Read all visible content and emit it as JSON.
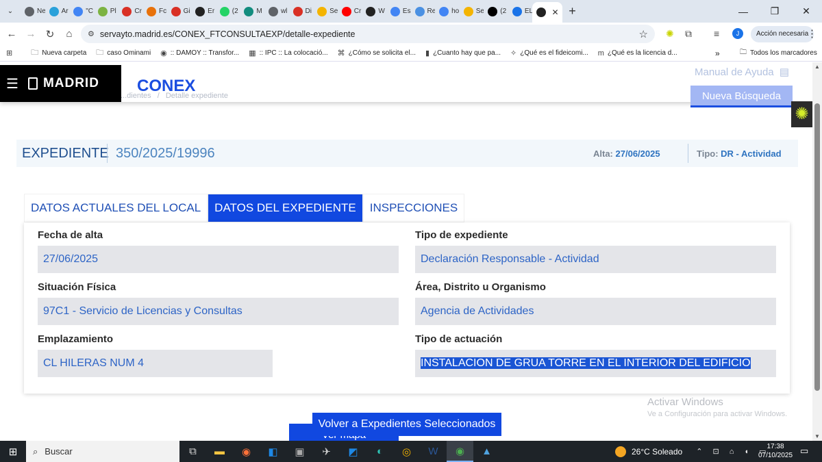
{
  "browser": {
    "tabs": [
      {
        "label": "Ne",
        "color": "#5f6368"
      },
      {
        "label": "Ar",
        "color": "#2aa1da"
      },
      {
        "label": "\"C",
        "color": "#4285f4"
      },
      {
        "label": "Pl",
        "color": "#7cb342"
      },
      {
        "label": "Cr",
        "color": "#d93025"
      },
      {
        "label": "Fc",
        "color": "#e8710a"
      },
      {
        "label": "Gi",
        "color": "#d93025"
      },
      {
        "label": "Er",
        "color": "#222222"
      },
      {
        "label": "(2",
        "color": "#25d366"
      },
      {
        "label": "M",
        "color": "#128c7e"
      },
      {
        "label": "wl",
        "color": "#5f6368"
      },
      {
        "label": "Di",
        "color": "#d93025"
      },
      {
        "label": "Se",
        "color": "#f4b400"
      },
      {
        "label": "Cr",
        "color": "#ff0000"
      },
      {
        "label": "W",
        "color": "#222222"
      },
      {
        "label": "Es",
        "color": "#4285f4"
      },
      {
        "label": "Re",
        "color": "#4a90e2"
      },
      {
        "label": "ho",
        "color": "#4285f4"
      },
      {
        "label": "Se",
        "color": "#f4b400"
      },
      {
        "label": "(2",
        "color": "#000000"
      },
      {
        "label": "EL",
        "color": "#1a73e8"
      }
    ],
    "active_tab_close": "✕",
    "new_tab": "+",
    "url": "servayto.madrid.es/CONEX_FTCONSULTAEXP/detalle-expediente",
    "accion_necesaria": "Acción necesaria",
    "profile_initial": "J",
    "bookmarks": [
      {
        "icon": "⊞",
        "label": ""
      },
      {
        "icon": "🗀",
        "label": "Nueva carpeta"
      },
      {
        "icon": "🗀",
        "label": "caso Ominami"
      },
      {
        "icon": "◉",
        "label": ":: DAMOY :: Transfor..."
      },
      {
        "icon": "▦",
        "label": ":: IPC :: La colocació..."
      },
      {
        "icon": "⌘",
        "label": "¿Cómo se solicita el..."
      },
      {
        "icon": "▮",
        "label": "¿Cuanto hay que pa..."
      },
      {
        "icon": "✧",
        "label": "¿Qué es el fideicomi..."
      },
      {
        "icon": "m",
        "label": "¿Qué es la licencia d..."
      }
    ],
    "bookmarks_more": "»",
    "all_bookmarks": "Todos los marcadores"
  },
  "site": {
    "brand": "MADRID",
    "app_name": "CONEX",
    "breadcrumb_left": "...dientes",
    "breadcrumb_sep": "/",
    "breadcrumb_current": "Detalle expediente",
    "manual": "Manual de Ayuda",
    "nueva_busqueda": "Nueva Búsqueda"
  },
  "expediente": {
    "label": "EXPEDIENTE",
    "numero": "350/2025/19996",
    "alta_label": "Alta:",
    "alta_value": "27/06/2025",
    "tipo_label": "Tipo:",
    "tipo_value": "DR - Actividad"
  },
  "tabs": [
    {
      "label": "DATOS ACTUALES DEL LOCAL",
      "active": false
    },
    {
      "label": "DATOS DEL EXPEDIENTE",
      "active": true
    },
    {
      "label": "INSPECCIONES",
      "active": false
    }
  ],
  "fields": {
    "fecha_alta": {
      "label": "Fecha de alta",
      "value": "27/06/2025"
    },
    "tipo_expediente": {
      "label": "Tipo de expediente",
      "value": "Declaración Responsable - Actividad"
    },
    "situacion_fisica": {
      "label": "Situación Física",
      "value": "97C1 - Servicio de Licencias y Consultas"
    },
    "area": {
      "label": "Área, Distrito u Organismo",
      "value": "Agencia de Actividades"
    },
    "emplazamiento": {
      "label": "Emplazamiento",
      "value": "CL HILERAS NUM 4"
    },
    "tipo_actuacion": {
      "label": "Tipo de actuación",
      "value": "INSTALACION DE GRUA TORRE EN EL INTERIOR DEL EDIFICIO"
    }
  },
  "buttons": {
    "ver_mapa": "Ver mapa",
    "volver": "Volver a Expedientes Seleccionados"
  },
  "watermark": {
    "title": "Activar Windows",
    "subtitle": "Ve a Configuración para activar Windows."
  },
  "taskbar": {
    "search_placeholder": "Buscar",
    "weather": "26°C  Soleado",
    "time": "17:38",
    "date": "07/10/2025"
  }
}
